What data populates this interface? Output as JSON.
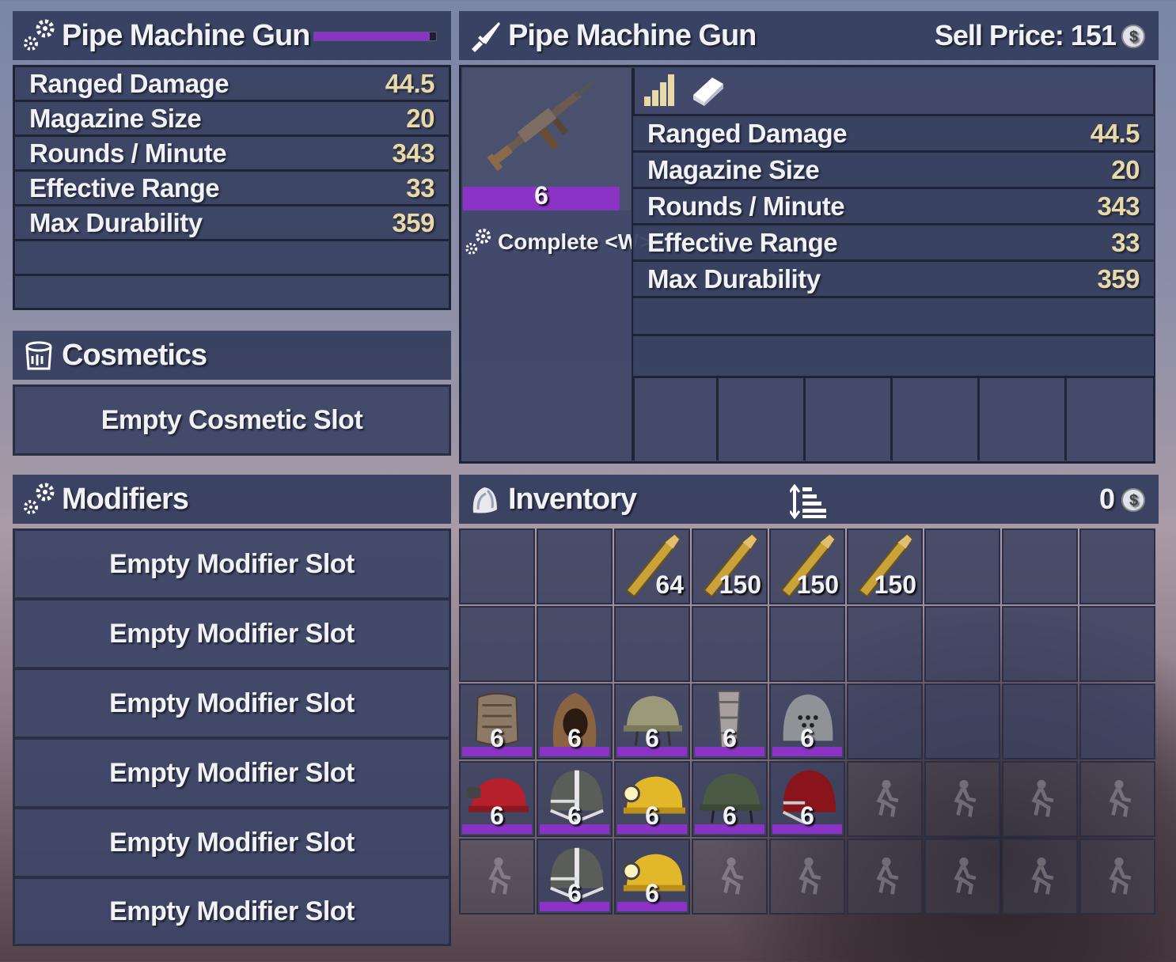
{
  "item_stats_panel": {
    "title": "Pipe Machine Gun",
    "durability_fraction": 0.95,
    "stats": [
      {
        "label": "Ranged Damage",
        "value": "44.5"
      },
      {
        "label": "Magazine Size",
        "value": "20"
      },
      {
        "label": "Rounds / Minute",
        "value": "343"
      },
      {
        "label": "Effective Range",
        "value": "33"
      },
      {
        "label": "Max Durability",
        "value": "359"
      }
    ]
  },
  "cosmetics": {
    "title": "Cosmetics",
    "slot_label": "Empty Cosmetic Slot"
  },
  "modifiers": {
    "title": "Modifiers",
    "slots": [
      "Empty Modifier Slot",
      "Empty Modifier Slot",
      "Empty Modifier Slot",
      "Empty Modifier Slot",
      "Empty Modifier Slot",
      "Empty Modifier Slot"
    ]
  },
  "item_info": {
    "title": "Pipe Machine Gun",
    "sell_price_label": "Sell Price: 151",
    "item_tier": "6",
    "complete_label": "Complete <W>",
    "stats": [
      {
        "label": "Ranged Damage",
        "value": "44.5"
      },
      {
        "label": "Magazine Size",
        "value": "20"
      },
      {
        "label": "Rounds / Minute",
        "value": "343"
      },
      {
        "label": "Effective Range",
        "value": "33"
      },
      {
        "label": "Max Durability",
        "value": "359"
      }
    ]
  },
  "inventory": {
    "title": "Inventory",
    "currency": "0",
    "rows": [
      [
        {
          "item": ""
        },
        {
          "item": ""
        },
        {
          "item": "ammo-icon",
          "qty": "64"
        },
        {
          "item": "ammo-icon",
          "qty": "150"
        },
        {
          "item": "ammo-icon",
          "qty": "150"
        },
        {
          "item": "ammo-icon",
          "qty": "150"
        },
        {
          "item": ""
        },
        {
          "item": ""
        },
        {
          "item": ""
        }
      ],
      [
        {
          "item": ""
        },
        {
          "item": ""
        },
        {
          "item": ""
        },
        {
          "item": ""
        },
        {
          "item": ""
        },
        {
          "item": ""
        },
        {
          "item": ""
        },
        {
          "item": ""
        },
        {
          "item": ""
        }
      ],
      [
        {
          "item": "chest-armor-icon",
          "qty": "6"
        },
        {
          "item": "hood-icon",
          "qty": "6"
        },
        {
          "item": "camo-helmet-icon",
          "qty": "6"
        },
        {
          "item": "leg-armor-icon",
          "qty": "6"
        },
        {
          "item": "visor-helmet-icon",
          "qty": "6"
        },
        {
          "item": ""
        },
        {
          "item": ""
        },
        {
          "item": ""
        },
        {
          "item": ""
        }
      ],
      [
        {
          "item": "red-mining-helmet-icon",
          "qty": "6"
        },
        {
          "item": "football-helmet-icon",
          "qty": "6"
        },
        {
          "item": "mining-helmet-icon",
          "qty": "6"
        },
        {
          "item": "military-helmet-icon",
          "qty": "6"
        },
        {
          "item": "red-football-helmet-icon",
          "qty": "6"
        },
        {
          "item": "locked"
        },
        {
          "item": "locked"
        },
        {
          "item": "locked"
        },
        {
          "item": "locked"
        }
      ],
      [
        {
          "item": "locked"
        },
        {
          "item": "football-helmet-icon",
          "qty": "6"
        },
        {
          "item": "mining-helmet-icon",
          "qty": "6"
        },
        {
          "item": "locked"
        },
        {
          "item": "locked"
        },
        {
          "item": "locked"
        },
        {
          "item": "locked"
        },
        {
          "item": "locked"
        },
        {
          "item": "locked"
        }
      ]
    ]
  },
  "colors": {
    "tier_purple": "#8a33c4",
    "stat_value": "#e8d9a8",
    "panel_bg": "#363e5e"
  }
}
